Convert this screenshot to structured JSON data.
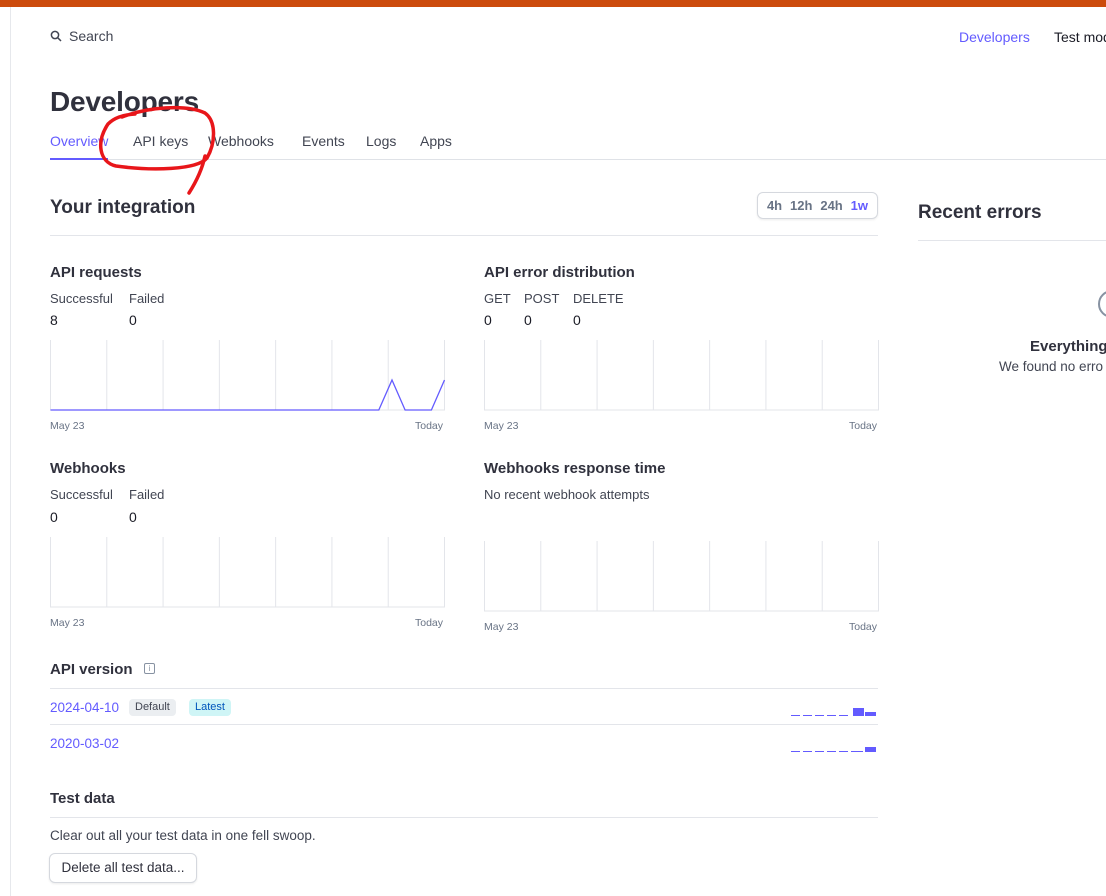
{
  "search": {
    "label": "Search"
  },
  "header": {
    "developers_link": "Developers",
    "test_mode": "Test mod"
  },
  "page": {
    "title": "Developers"
  },
  "tabs": [
    {
      "label": "Overview",
      "active": true
    },
    {
      "label": "API keys"
    },
    {
      "label": "Webhooks"
    },
    {
      "label": "Events"
    },
    {
      "label": "Logs"
    },
    {
      "label": "Apps"
    }
  ],
  "integration": {
    "title": "Your integration",
    "ranges": [
      "4h",
      "12h",
      "24h",
      "1w"
    ],
    "selected_range": "1w",
    "api_requests": {
      "title": "API requests",
      "successful_label": "Successful",
      "successful_value": "8",
      "failed_label": "Failed",
      "failed_value": "0",
      "axis_start": "May 23",
      "axis_end": "Today"
    },
    "api_errors": {
      "title": "API error distribution",
      "get_label": "GET",
      "get_value": "0",
      "post_label": "POST",
      "post_value": "0",
      "delete_label": "DELETE",
      "delete_value": "0",
      "axis_start": "May 23",
      "axis_end": "Today"
    },
    "webhooks": {
      "title": "Webhooks",
      "successful_label": "Successful",
      "successful_value": "0",
      "failed_label": "Failed",
      "failed_value": "0",
      "axis_start": "May 23",
      "axis_end": "Today"
    },
    "webhooks_response": {
      "title": "Webhooks response time",
      "empty": "No recent webhook attempts",
      "axis_start": "May 23",
      "axis_end": "Today"
    }
  },
  "api_version": {
    "title": "API version",
    "info_icon": "i",
    "versions": [
      {
        "version": "2024-04-10",
        "badges": [
          "Default",
          "Latest"
        ]
      },
      {
        "version": "2020-03-02",
        "badges": []
      }
    ]
  },
  "test_data": {
    "title": "Test data",
    "description": "Clear out all your test data in one fell swoop.",
    "delete_button": "Delete all test data..."
  },
  "recent_errors": {
    "title": "Recent errors",
    "empty_title": "Everything",
    "empty_sub": "We found no erro"
  },
  "colors": {
    "accent": "#635bff",
    "topbar": "#cc4b0c",
    "annotation": "#e8161a"
  },
  "chart_data": [
    {
      "type": "line",
      "title": "API requests",
      "x": [
        "May 23",
        "Today"
      ],
      "series": [
        {
          "values": [
            0,
            0,
            0,
            0,
            0,
            0,
            0,
            0,
            0,
            0,
            0,
            0,
            0,
            0,
            0,
            0,
            0,
            0,
            0,
            0,
            0,
            0,
            0,
            0,
            0,
            0,
            1,
            0,
            0,
            0,
            1
          ]
        }
      ],
      "ylim": [
        0,
        1
      ]
    },
    {
      "type": "line",
      "title": "API error distribution",
      "x": [
        "May 23",
        "Today"
      ],
      "series": []
    },
    {
      "type": "line",
      "title": "Webhooks",
      "x": [
        "May 23",
        "Today"
      ],
      "series": []
    },
    {
      "type": "line",
      "title": "Webhooks response time",
      "x": [
        "May 23",
        "Today"
      ],
      "series": []
    }
  ]
}
